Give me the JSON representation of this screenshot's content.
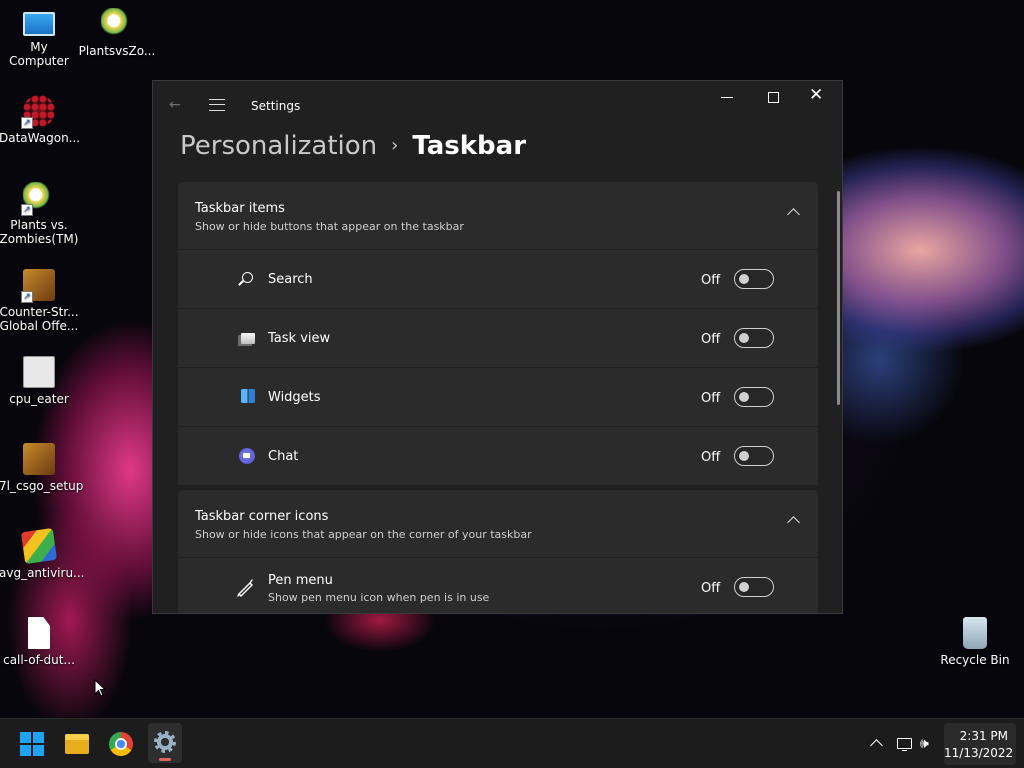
{
  "desktop": {
    "icons": [
      {
        "label": "My Computer",
        "icon": "monitor-icon"
      },
      {
        "label": "PlantsvsZo...",
        "icon": "plants-icon"
      },
      {
        "label": "DataWagon...",
        "icon": "datawagon-icon"
      },
      {
        "label": "Plants vs. Zombies(TM)",
        "icon": "plants-icon"
      },
      {
        "label": "Counter-Str... Global Offe...",
        "icon": "counter-strike-icon"
      },
      {
        "label": "cpu_eater",
        "icon": "app-gear-icon"
      },
      {
        "label": "7l_csgo_setup",
        "icon": "counter-strike-icon"
      },
      {
        "label": "avg_antiviru...",
        "icon": "avg-icon"
      },
      {
        "label": "call-of-dut...",
        "icon": "file-icon"
      },
      {
        "label": "Recycle Bin",
        "icon": "recycle-bin-icon"
      }
    ]
  },
  "settings": {
    "window_title": "Settings",
    "breadcrumb": {
      "parent": "Personalization",
      "separator": "›",
      "current": "Taskbar"
    },
    "sections": [
      {
        "title": "Taskbar items",
        "subtitle": "Show or hide buttons that appear on the taskbar",
        "items": [
          {
            "label": "Search",
            "state": "Off"
          },
          {
            "label": "Task view",
            "state": "Off"
          },
          {
            "label": "Widgets",
            "state": "Off"
          },
          {
            "label": "Chat",
            "state": "Off"
          }
        ]
      },
      {
        "title": "Taskbar corner icons",
        "subtitle": "Show or hide icons that appear on the corner of your taskbar",
        "items": [
          {
            "label": "Pen menu",
            "subtitle": "Show pen menu icon when pen is in use",
            "state": "Off"
          }
        ]
      }
    ]
  },
  "taskbar": {
    "apps": [
      "start-icon",
      "file-explorer-icon",
      "chrome-icon",
      "settings-icon"
    ],
    "clock": {
      "time": "2:31 PM",
      "date": "11/13/2022"
    }
  },
  "colors": {
    "accent": "#1fa3f2",
    "window_bg": "#202020",
    "card_bg": "#2b2b2b",
    "active_indicator": "#e0665e"
  }
}
